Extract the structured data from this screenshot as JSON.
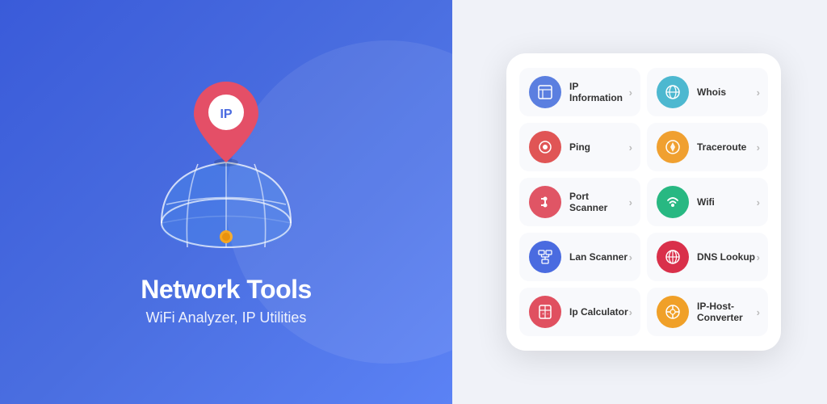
{
  "left": {
    "title": "Network Tools",
    "subtitle": "WiFi Analyzer, IP Utilities"
  },
  "right": {
    "tools": [
      {
        "id": "ip-information",
        "label": "IP Information",
        "icon": "🗺",
        "color": "icon-blue"
      },
      {
        "id": "whois",
        "label": "Whois",
        "icon": "🌐",
        "color": "icon-teal"
      },
      {
        "id": "ping",
        "label": "Ping",
        "icon": "🔍",
        "color": "icon-red"
      },
      {
        "id": "traceroute",
        "label": "Traceroute",
        "icon": "↻",
        "color": "icon-orange"
      },
      {
        "id": "port-scanner",
        "label": "Port Scanner",
        "icon": "⚡",
        "color": "icon-usb"
      },
      {
        "id": "wifi",
        "label": "Wifi",
        "icon": "▦",
        "color": "icon-green"
      },
      {
        "id": "lan-scanner",
        "label": "Lan Scanner",
        "icon": "⊞",
        "color": "icon-darkblue"
      },
      {
        "id": "dns-lookup",
        "label": "DNS Lookup",
        "icon": "⊕",
        "color": "icon-crimson"
      },
      {
        "id": "ip-calculator",
        "label": "Ip Calculator",
        "icon": "⊞",
        "color": "icon-calc"
      },
      {
        "id": "ip-host-converter",
        "label": "IP-Host-Converter",
        "icon": "⊕",
        "color": "icon-amber"
      }
    ],
    "chevron": "›"
  }
}
